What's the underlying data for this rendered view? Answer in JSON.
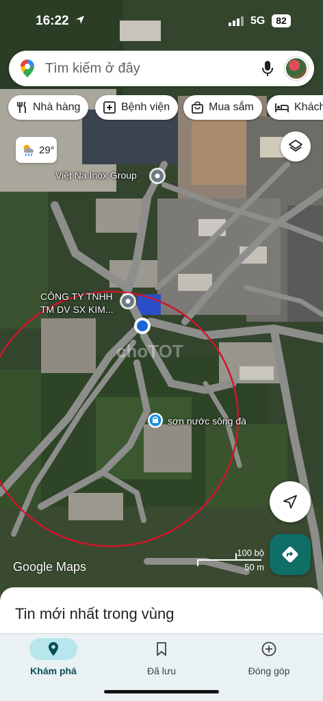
{
  "status_bar": {
    "time": "16:22",
    "network": "5G",
    "battery": "82"
  },
  "search": {
    "placeholder": "Tìm kiếm ở đây"
  },
  "chips": [
    {
      "label": "Nhà hàng",
      "icon": "restaurant-icon"
    },
    {
      "label": "Bệnh viện",
      "icon": "hospital-icon"
    },
    {
      "label": "Mua sắm",
      "icon": "shopping-bag-icon"
    },
    {
      "label": "Khách",
      "icon": "bed-icon"
    }
  ],
  "weather": {
    "temp": "29°",
    "icon": "partly-cloudy-rain-icon"
  },
  "map": {
    "places": {
      "viet_na": "Việt Na Inox Group",
      "cong_ty_line1": "CÔNG TY TNHH",
      "cong_ty_line2": "TM DV SX KIM...",
      "son_nuoc": "sơn nước sông đà"
    },
    "watermark": "choTOT",
    "brand": "Google Maps",
    "scale": {
      "imperial": "100 bộ",
      "metric": "50 m"
    },
    "colors": {
      "circle": "#d0152b",
      "pin": "#1a66d6",
      "direction": "#0f6e66"
    }
  },
  "sheet": {
    "title": "Tin mới nhất trong vùng"
  },
  "bottom_nav": [
    {
      "label": "Khám phá",
      "icon": "explore-pin-icon",
      "active": true
    },
    {
      "label": "Đã lưu",
      "icon": "bookmark-icon",
      "active": false
    },
    {
      "label": "Đóng góp",
      "icon": "add-circle-icon",
      "active": false
    }
  ]
}
